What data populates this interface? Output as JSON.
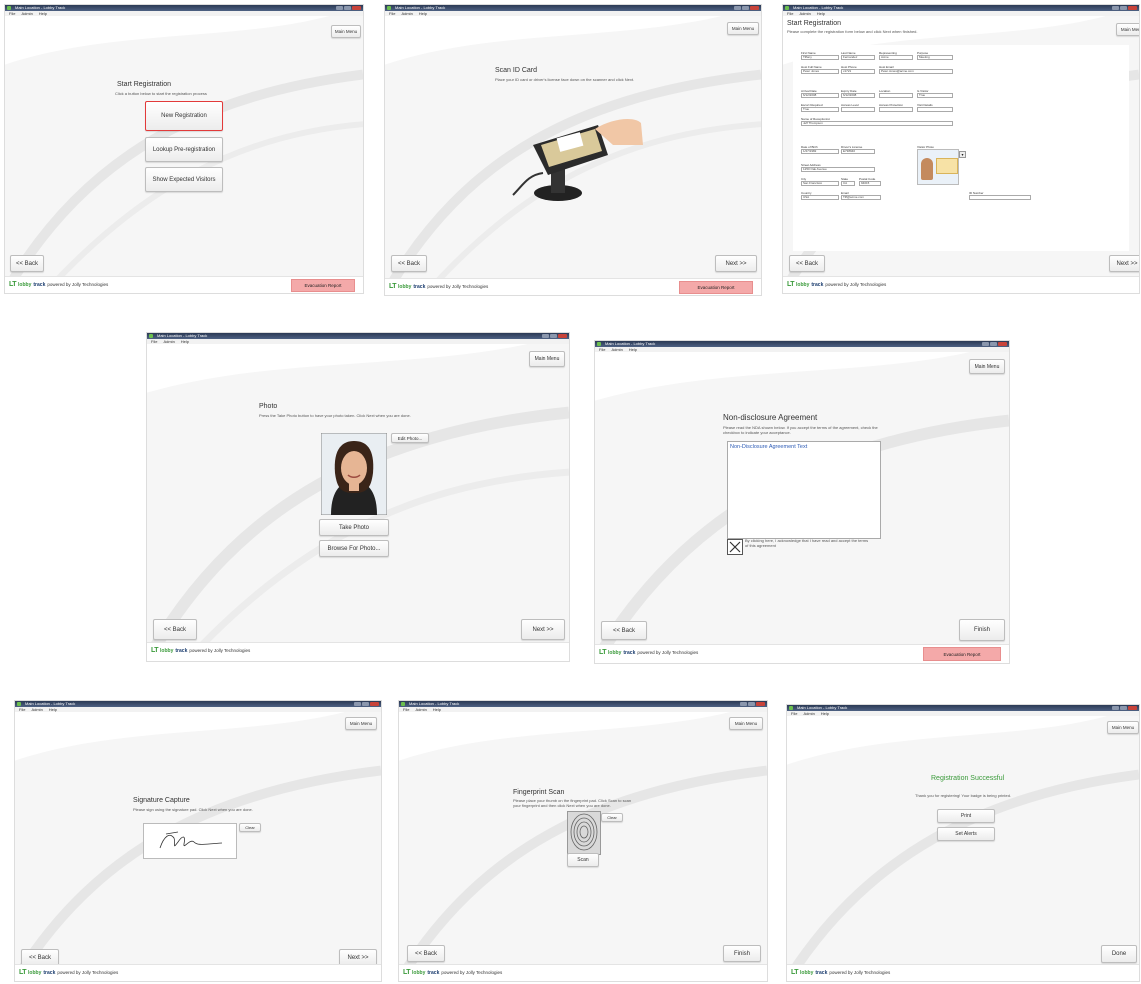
{
  "app": {
    "window_title": "Main Location - Lobby Track",
    "menu": [
      "File",
      "Admin",
      "Help"
    ],
    "main_menu": "Main Menu",
    "back": "<< Back",
    "next": "Next >>",
    "finish": "Finish",
    "done": "Done",
    "evacuation_report": "Evacuation Report",
    "brand_logo": "LT",
    "brand_lobby": "lobby",
    "brand_track": "track",
    "brand_powered": "powered by Jolly Technologies",
    "colors": {
      "accent_green": "#3a9a3a",
      "evac_bg": "#f4a9a9",
      "selected_border": "#e23a3a",
      "title_bar": "#2b3a55"
    }
  },
  "start": {
    "title": "Start Registration",
    "subtitle": "Click a button below to start the registration process",
    "new_registration": "New Registration",
    "lookup": "Lookup Pre-registration",
    "show_expected": "Show Expected Visitors"
  },
  "scan": {
    "title": "Scan ID Card",
    "subtitle": "Place your ID card or driver's license face down on the scanner and click Next."
  },
  "form": {
    "title": "Start Registration",
    "subtitle": "Please complete the registration form below and click Next when finished.",
    "labels": {
      "first_name": "First Name",
      "last_name": "Last Name",
      "representing": "Representing",
      "purpose": "Purpose",
      "host_full_name": "Host Full Name",
      "host_phone": "Host Phone",
      "host_email": "Host Email",
      "arrival_date": "Arrival Date",
      "expiry_date": "Expiry Date",
      "location": "Location",
      "vip_badge": "Is Visitor",
      "escort_required": "Escort Required",
      "access_level": "Access Level",
      "access_protection": "Access Protection",
      "visit_details": "Visit Details",
      "name_of_receptionist": "Name of Receptionist",
      "date_of_birth": "Date of Birth",
      "drivers_license": "Driver's License",
      "visitor_photo": "Visitor Photo",
      "street_address": "Street Address",
      "city": "City",
      "state": "State",
      "postal_code": "Postal Code",
      "country": "Country",
      "email": "Email",
      "id_number": "ID Number"
    },
    "values": {
      "first_name": "Tiffany",
      "last_name": "Fernandez",
      "representing": "Acme",
      "purpose": "Meeting",
      "host_full_name": "Peter Jones",
      "host_phone": "x1721",
      "host_email": "Peter.Jones@acme.com",
      "arrival_date": "6/12/2008",
      "expiry_date": "6/12/2008",
      "vip_badge": "True",
      "escort_required": "True",
      "name_of_receptionist": "Jeff Thompson",
      "date_of_birth": "1/27/1982",
      "drivers_license": "E738940",
      "street_address": "1250 Oak Avenue",
      "city": "San Francisco",
      "state": "CA",
      "postal_code": "94015",
      "country": "USA",
      "email": "Tiff@acme.com"
    }
  },
  "photo": {
    "title": "Photo",
    "subtitle": "Press the Take Photo button to have your photo taken. Click Next when you are done.",
    "edit_photo": "Edit Photo...",
    "take_photo": "Take Photo",
    "browse_photo": "Browse For Photo..."
  },
  "nda": {
    "title": "Non-disclosure Agreement",
    "subtitle": "Please read the NDA shown below. If you accept the terms of the agreement, check the checkbox to indicate your acceptance.",
    "agreement_text": "Non-Disclosure Agreement Text",
    "acknowledge": "By clicking here, I acknowledge that I have read and accept the terms of this agreement"
  },
  "signature": {
    "title": "Signature Capture",
    "subtitle": "Please sign using the signature pad. Click Next when you are done.",
    "clear": "Clear"
  },
  "fingerprint": {
    "title": "Fingerprint Scan",
    "subtitle": "Please place your thumb on the fingerprint pad. Click Scan to scan your fingerprint and then click Next when you are done.",
    "clear": "Clear",
    "scan": "Scan"
  },
  "success": {
    "title": "Registration Successful",
    "subtitle": "Thank you for registering! Your badge is being printed.",
    "print": "Print",
    "set_alerts": "Set Alerts"
  }
}
